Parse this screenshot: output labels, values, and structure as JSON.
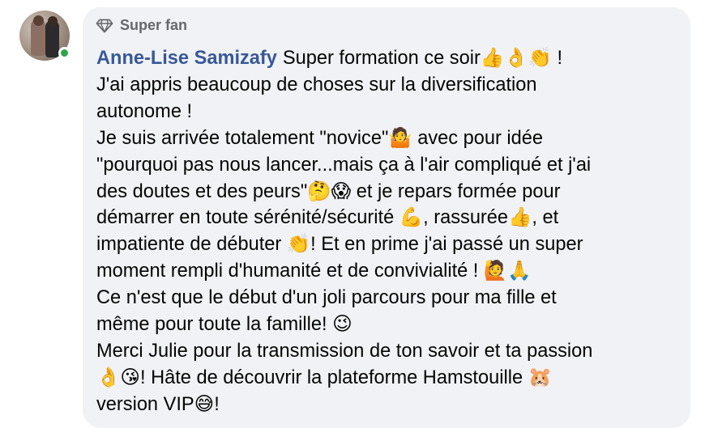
{
  "avatar": {
    "icon": "profile-photo"
  },
  "status": {
    "online_color": "#31a24c"
  },
  "badge": {
    "label": "Super fan",
    "icon": "diamond-icon"
  },
  "comment": {
    "author": "Anne-Lise Samizafy",
    "lines": [
      "Super formation ce soir👍👌👏 !",
      "J'ai appris beaucoup de choses sur la diversification",
      "autonome !",
      "Je suis arrivée totalement \"novice\"🤷 avec pour idée",
      "\"pourquoi pas nous lancer...mais ça à l'air compliqué et j'ai",
      "des doutes et des peurs\"🤔😱 et je repars formée pour",
      "démarrer en toute sérénité/sécurité 💪, rassurée👍, et",
      "impatiente de débuter 👏! Et en prime j'ai passé un super",
      "moment rempli d'humanité et de convivialité ! 🙋🙏",
      "Ce n'est que le début d'un joli parcours pour ma fille et",
      "même pour toute la famille! 😉",
      "Merci Julie pour la transmission de ton savoir et ta passion",
      "👌😘! Hâte de découvrir la plateforme Hamstouille 🐹",
      "version VIP😅!"
    ]
  },
  "colors": {
    "bubble": "#f0f2f5",
    "author": "#385898",
    "text": "#050505",
    "badge": "#65676b"
  }
}
